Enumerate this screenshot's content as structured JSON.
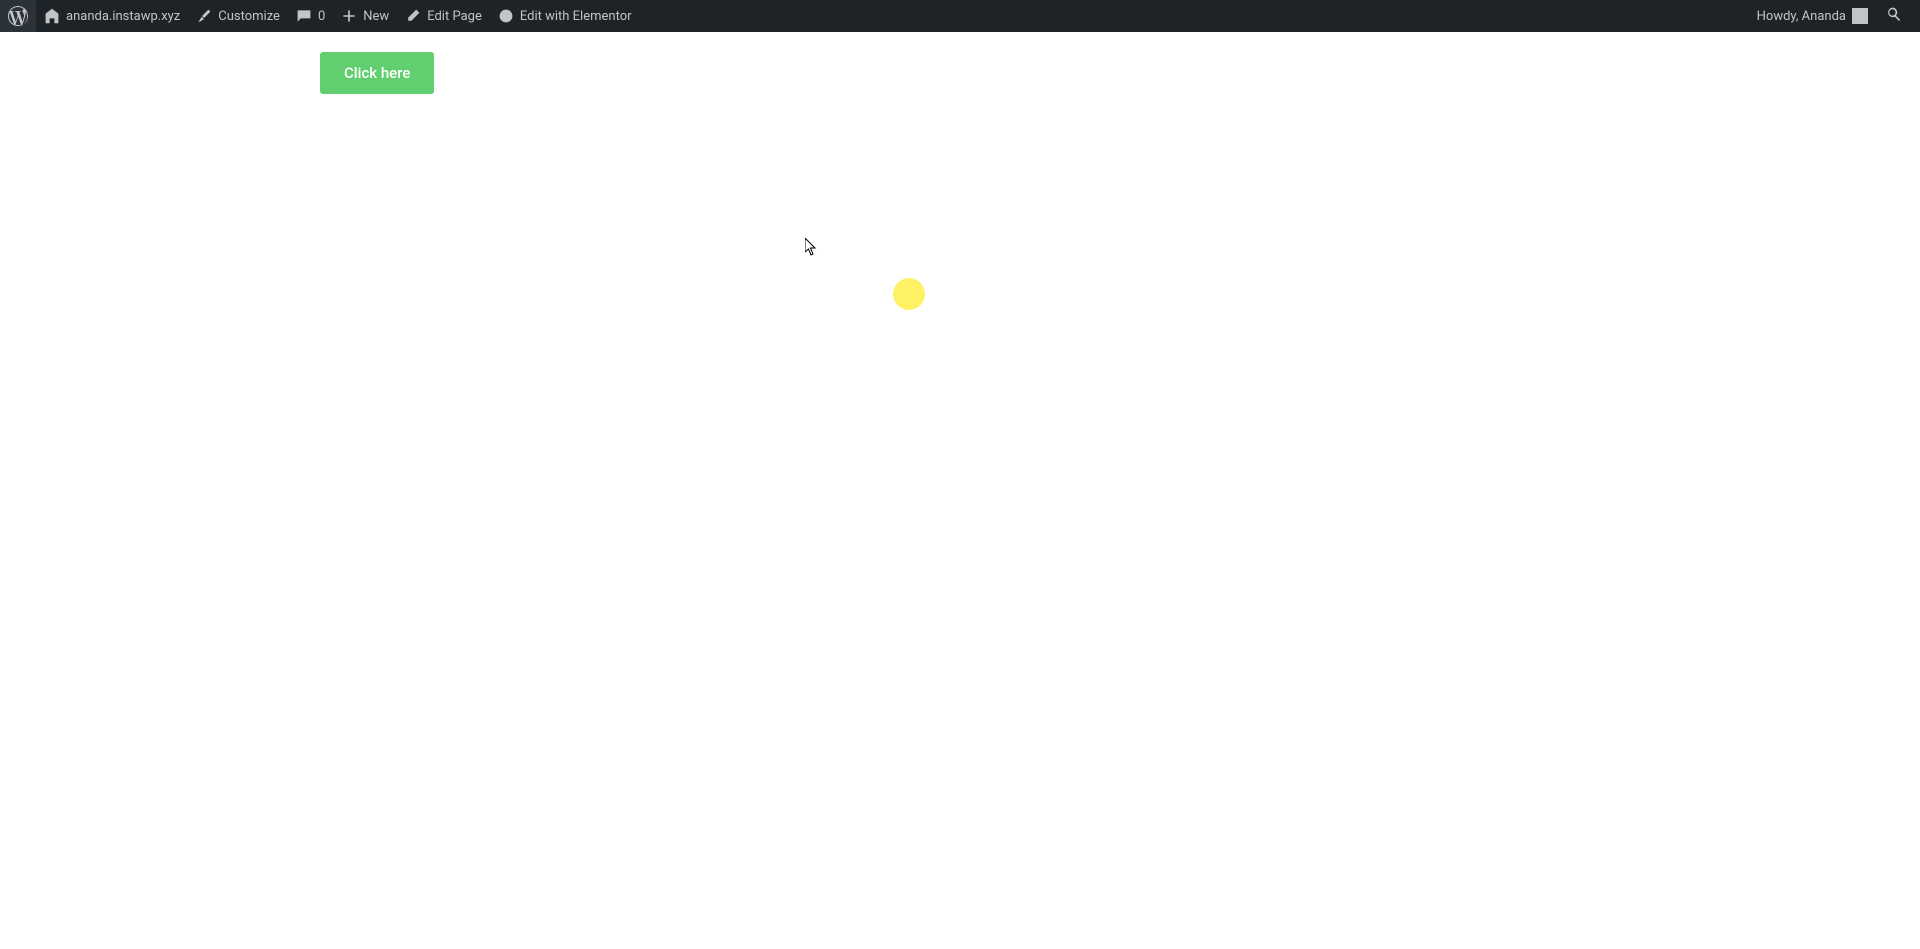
{
  "adminBar": {
    "siteName": "ananda.instawp.xyz",
    "customize": "Customize",
    "commentsCount": "0",
    "newLabel": "New",
    "editPage": "Edit Page",
    "editElementor": "Edit with Elementor",
    "greeting": "Howdy, Ananda"
  },
  "content": {
    "buttonLabel": "Click here"
  }
}
